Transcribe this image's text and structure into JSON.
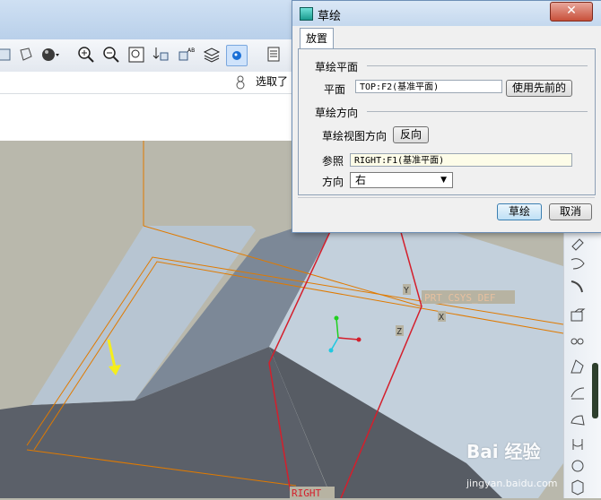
{
  "app": {
    "status_select_label": "选取了"
  },
  "viewport": {
    "csys_label": "PRT_CSYS_DEF",
    "axis_x": "X",
    "axis_y": "Y",
    "axis_z": "Z",
    "right_plane_label": "RIGHT",
    "colors": {
      "background": "#b9b8ac",
      "part_top": "#b6c3cf",
      "part_side": "#5b6069",
      "datum": "#e07a00",
      "sketch_plane": "#d41f2c"
    }
  },
  "dialog": {
    "title": "草绘",
    "close_label": "✕",
    "tabs": [
      "放置"
    ],
    "sketch_plane_section": "草绘平面",
    "plane_label": "平面",
    "plane_value": "TOP:F2(基准平面)",
    "use_previous_button": "使用先前的",
    "orientation_section": "草绘方向",
    "view_direction_label": "草绘视图方向",
    "flip_button": "反向",
    "reference_label": "参照",
    "reference_value": "RIGHT:F1(基准平面)",
    "direction_label": "方向",
    "direction_value": "右",
    "sketch_button": "草绘",
    "cancel_button": "取消"
  },
  "watermark": {
    "brand": "Bai 经验",
    "url": "jingyan.baidu.com"
  },
  "toolbar_icons": [
    "sketch-icon",
    "shade-icon",
    "zoom-in-icon",
    "zoom-out-icon",
    "refit-icon",
    "orient-icon",
    "saved-views-icon",
    "layers-icon",
    "spin-center-icon",
    "appearance-icon"
  ],
  "right_toolbar_icons": [
    "extrude-icon",
    "revolve-icon",
    "sweep-icon",
    "shell-icon",
    "rib-icon",
    "draft-icon",
    "round-icon",
    "chamfer-icon",
    "hole-icon",
    "pattern-icon",
    "mirror-icon"
  ]
}
